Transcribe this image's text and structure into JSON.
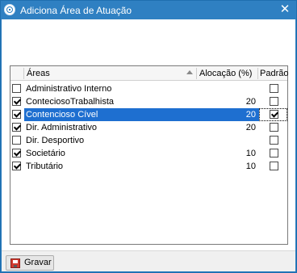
{
  "window": {
    "title": "Adiciona Área de Atuação"
  },
  "grid": {
    "columns": {
      "areas": "Áreas",
      "alocacao": "Alocação (%)",
      "padrao": "Padrão"
    },
    "rows": [
      {
        "name": "Administrativo Interno",
        "checked": false,
        "alocacao": "",
        "padrao": false,
        "selected": false
      },
      {
        "name": "ConteciosoTrabalhista",
        "checked": true,
        "alocacao": "20",
        "padrao": false,
        "selected": false
      },
      {
        "name": "Contencioso Cível",
        "checked": true,
        "alocacao": "20",
        "padrao": true,
        "selected": true
      },
      {
        "name": "Dir. Administrativo",
        "checked": true,
        "alocacao": "20",
        "padrao": false,
        "selected": false
      },
      {
        "name": "Dir. Desportivo",
        "checked": false,
        "alocacao": "",
        "padrao": false,
        "selected": false
      },
      {
        "name": "Societário",
        "checked": true,
        "alocacao": "10",
        "padrao": false,
        "selected": false
      },
      {
        "name": "Tributário",
        "checked": true,
        "alocacao": "10",
        "padrao": false,
        "selected": false
      }
    ]
  },
  "footer": {
    "save_label": "Gravar"
  },
  "icons": {
    "app": "app-globe-icon",
    "close": "close-icon",
    "sort": "sort-ascending-icon",
    "save": "floppy-disk-icon"
  },
  "colors": {
    "titlebar": "#2f80c2",
    "selection": "#1e6fd0"
  }
}
